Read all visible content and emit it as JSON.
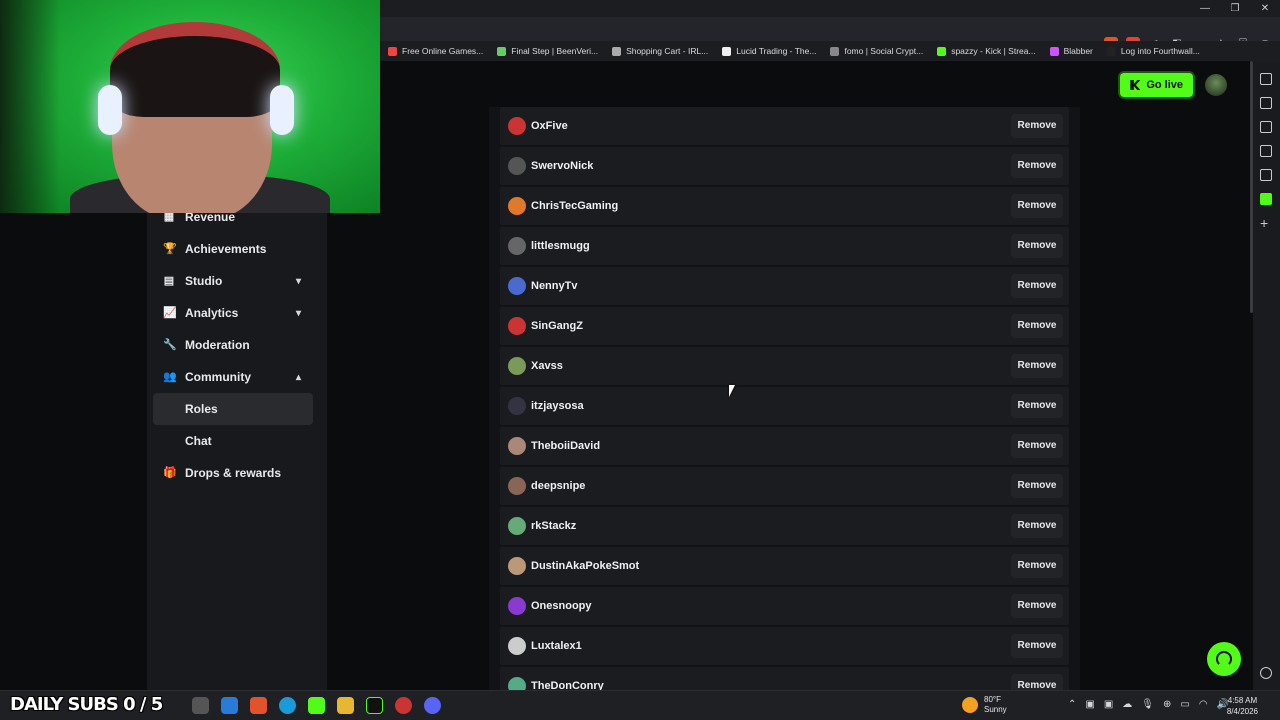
{
  "window": {
    "minimize": "—",
    "restore": "❐",
    "close": "✕"
  },
  "bookmarks": [
    {
      "label": "Free Online Games...",
      "color": "#e44"
    },
    {
      "label": "Final Step | BeenVeri...",
      "color": "#6c6"
    },
    {
      "label": "Shopping Cart - IRL...",
      "color": "#aaa"
    },
    {
      "label": "Lucid Trading - The...",
      "color": "#eee"
    },
    {
      "label": "fomo | Social Crypt...",
      "color": "#888"
    },
    {
      "label": "spazzy - Kick | Strea...",
      "color": "#53fc18"
    },
    {
      "label": "Blabber",
      "color": "#c5f"
    },
    {
      "label": "Log into Fourthwall...",
      "color": "#222"
    }
  ],
  "header": {
    "go_live_label": "Go live"
  },
  "sidebar": {
    "items": [
      {
        "label": "Revenue",
        "icon": "revenue-icon",
        "glyph": "▦"
      },
      {
        "label": "Achievements",
        "icon": "trophy-icon",
        "glyph": "🏆"
      },
      {
        "label": "Studio",
        "icon": "studio-icon",
        "glyph": "▤",
        "chevron": "▾"
      },
      {
        "label": "Analytics",
        "icon": "analytics-icon",
        "glyph": "📈",
        "chevron": "▾"
      },
      {
        "label": "Moderation",
        "icon": "wrench-icon",
        "glyph": "🔧"
      },
      {
        "label": "Community",
        "icon": "community-icon",
        "glyph": "👥",
        "chevron": "▴"
      },
      {
        "label": "Roles",
        "icon": "",
        "glyph": ""
      },
      {
        "label": "Chat",
        "icon": "",
        "glyph": ""
      },
      {
        "label": "Drops & rewards",
        "icon": "drops-icon",
        "glyph": "🎁"
      }
    ]
  },
  "roles_list": {
    "remove_label": "Remove",
    "users": [
      {
        "name": "OxFive",
        "color": "#c33"
      },
      {
        "name": "SwervoNick",
        "color": "#555"
      },
      {
        "name": "ChrisTecGaming",
        "color": "#e07a2a"
      },
      {
        "name": "littlesmugg",
        "color": "#666"
      },
      {
        "name": "NennyTv",
        "color": "#4a6ad0"
      },
      {
        "name": "SinGangZ",
        "color": "#c33"
      },
      {
        "name": "Xavss",
        "color": "#7a9a5a"
      },
      {
        "name": "itzjaysosa",
        "color": "#334"
      },
      {
        "name": "TheboiiDavid",
        "color": "#a87"
      },
      {
        "name": "deepsnipe",
        "color": "#865"
      },
      {
        "name": "rkStackz",
        "color": "#6a7"
      },
      {
        "name": "DustinAkaPokeSmot",
        "color": "#b97"
      },
      {
        "name": "Onesnoopy",
        "color": "#8a3ad0"
      },
      {
        "name": "Luxtalex1",
        "color": "#ccc"
      },
      {
        "name": "TheDonConry",
        "color": "#5a8"
      }
    ]
  },
  "taskbar": {
    "overlay_text": "DAILY SUBS 0 / 5",
    "weather_temp": "80°F",
    "weather_desc": "Sunny",
    "time": "4:58 AM",
    "date": "8/4/2026"
  }
}
